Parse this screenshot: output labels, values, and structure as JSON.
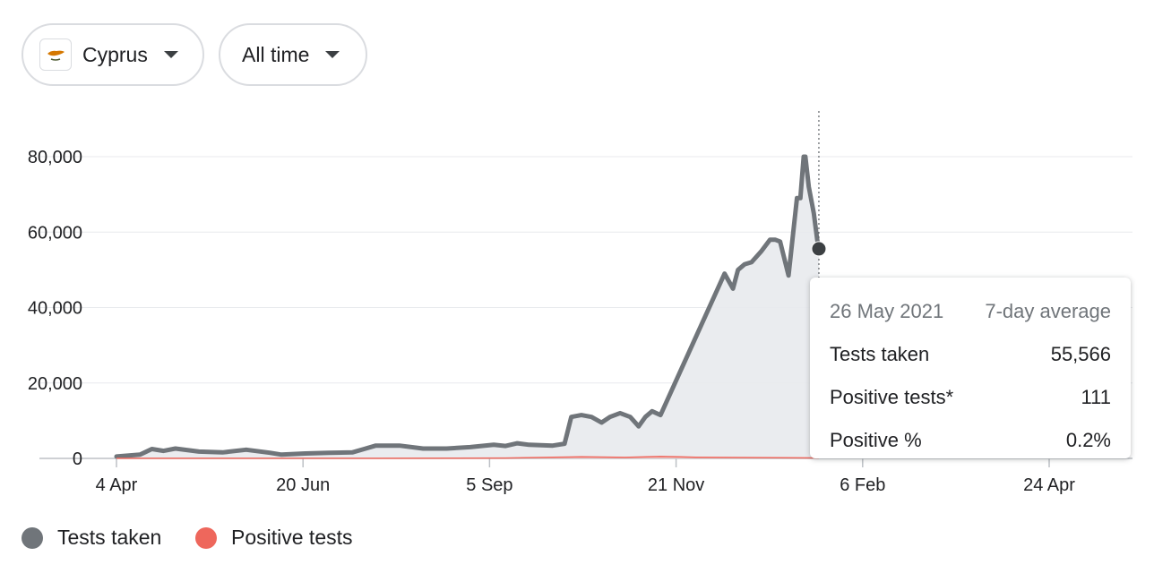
{
  "filters": {
    "country": "Cyprus",
    "time_range": "All time"
  },
  "legend": [
    {
      "label": "Tests taken",
      "color": "#70757a"
    },
    {
      "label": "Positive tests",
      "color": "#ee675c"
    }
  ],
  "tooltip": {
    "date": "26 May 2021",
    "mode": "7-day average",
    "rows": [
      {
        "label": "Tests taken",
        "value": "55,566"
      },
      {
        "label": "Positive tests*",
        "value": "111"
      },
      {
        "label": "Positive %",
        "value": "0.2%"
      }
    ]
  },
  "chart_data": {
    "type": "area",
    "x_tick_labels": [
      "4 Apr",
      "20 Jun",
      "5 Sep",
      "21 Nov",
      "6 Feb",
      "24 Apr"
    ],
    "y_tick_labels": [
      "0",
      "20,000",
      "40,000",
      "60,000",
      "80,000"
    ],
    "ylim": [
      0,
      80000
    ],
    "grid": true,
    "legend_position": "bottom-left",
    "series": [
      {
        "name": "Tests taken",
        "color": "#70757a",
        "points": [
          [
            "2020-04-04",
            500
          ],
          [
            "2020-04-18",
            1000
          ],
          [
            "2020-04-25",
            2500
          ],
          [
            "2020-05-02",
            2000
          ],
          [
            "2020-05-09",
            2600
          ],
          [
            "2020-05-23",
            1800
          ],
          [
            "2020-06-06",
            1600
          ],
          [
            "2020-06-20",
            2300
          ],
          [
            "2020-07-04",
            1500
          ],
          [
            "2020-07-11",
            1000
          ],
          [
            "2020-07-25",
            1300
          ],
          [
            "2020-08-08",
            1500
          ],
          [
            "2020-08-22",
            1600
          ],
          [
            "2020-08-29",
            2500
          ],
          [
            "2020-09-05",
            3400
          ],
          [
            "2020-09-19",
            3400
          ],
          [
            "2020-10-03",
            2600
          ],
          [
            "2020-10-17",
            2600
          ],
          [
            "2020-10-31",
            3000
          ],
          [
            "2020-11-14",
            3600
          ],
          [
            "2020-11-21",
            3300
          ],
          [
            "2020-11-28",
            4000
          ],
          [
            "2020-12-05",
            3600
          ],
          [
            "2020-12-19",
            3400
          ],
          [
            "2020-12-26",
            3900
          ],
          [
            "2020-12-30",
            11000
          ],
          [
            "2021-01-05",
            11500
          ],
          [
            "2021-01-11",
            11000
          ],
          [
            "2021-01-17",
            9500
          ],
          [
            "2021-01-22",
            11000
          ],
          [
            "2021-01-28",
            12000
          ],
          [
            "2021-02-03",
            11000
          ],
          [
            "2021-02-08",
            8500
          ],
          [
            "2021-02-12",
            11000
          ],
          [
            "2021-02-16",
            12500
          ],
          [
            "2021-02-21",
            11500
          ],
          [
            "2021-03-31",
            49000
          ],
          [
            "2021-04-05",
            45000
          ],
          [
            "2021-04-08",
            50000
          ],
          [
            "2021-04-12",
            51500
          ],
          [
            "2021-04-16",
            52000
          ],
          [
            "2021-04-22",
            55000
          ],
          [
            "2021-04-27",
            58000
          ],
          [
            "2021-04-30",
            58000
          ],
          [
            "2021-05-03",
            57500
          ],
          [
            "2021-05-08",
            48500
          ],
          [
            "2021-05-13",
            69000
          ],
          [
            "2021-05-15",
            69000
          ],
          [
            "2021-05-17",
            80000
          ],
          [
            "2021-05-18",
            80000
          ],
          [
            "2021-05-20",
            72000
          ],
          [
            "2021-05-23",
            65000
          ],
          [
            "2021-05-25",
            58000
          ],
          [
            "2021-05-26",
            55566
          ]
        ]
      },
      {
        "name": "Positive tests",
        "color": "#ee675c",
        "points": [
          [
            "2020-04-04",
            20
          ],
          [
            "2020-09-05",
            20
          ],
          [
            "2020-10-20",
            60
          ],
          [
            "2020-11-21",
            100
          ],
          [
            "2020-12-19",
            300
          ],
          [
            "2021-01-05",
            400
          ],
          [
            "2021-01-31",
            250
          ],
          [
            "2021-02-21",
            500
          ],
          [
            "2021-03-14",
            300
          ],
          [
            "2021-05-26",
            111
          ]
        ]
      }
    ]
  }
}
